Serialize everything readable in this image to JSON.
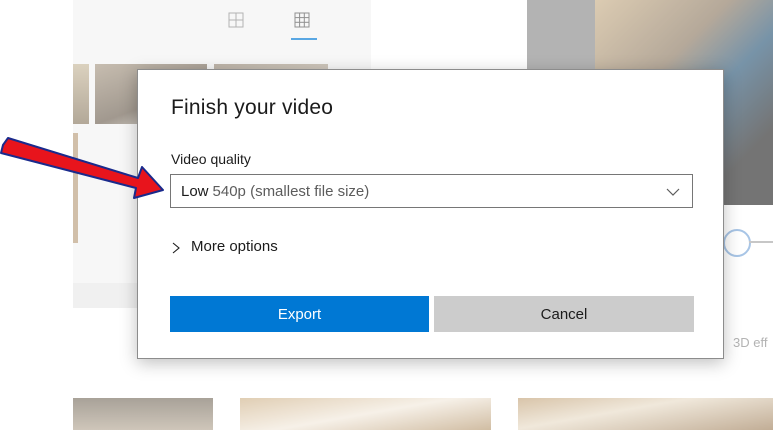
{
  "background": {
    "label_3d": "3D eff"
  },
  "dialog": {
    "title": "Finish your video",
    "quality_label": "Video quality",
    "quality_select": {
      "selected_strong": "Low",
      "selected_rest": "540p (smallest file size)"
    },
    "more_options": "More options",
    "export_button": "Export",
    "cancel_button": "Cancel"
  },
  "colors": {
    "accent": "#0078d4",
    "cancel_bg": "#cccccc",
    "arrow_red": "#e8141c",
    "arrow_outline": "#1a2a8c"
  },
  "icons": {
    "toolbar": [
      "grid-small-icon",
      "grid-large-icon"
    ],
    "select": "chevron-down-icon",
    "more": "chevron-right-icon"
  }
}
